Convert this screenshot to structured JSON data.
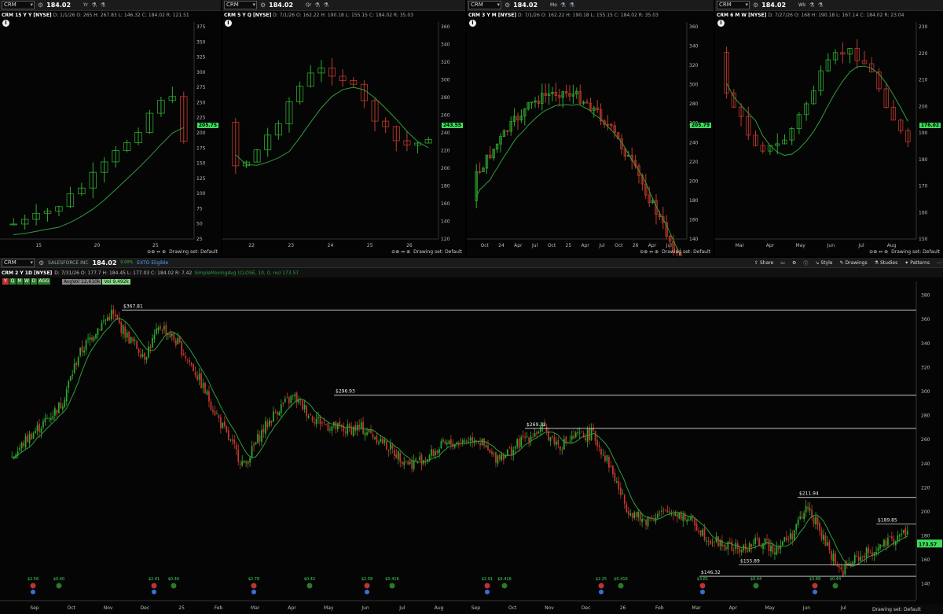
{
  "panels": [
    {
      "symbol": "CRM",
      "title": "CRM 15 Y Y [NYSE]",
      "price": "184.02",
      "period": "Yr",
      "stats": "D: 1/1/26  O: 265  H: 267.83  L: 146.32  C: 184.02  R: 121.51",
      "yticks": [
        "375",
        "350",
        "325",
        "300",
        "275",
        "250",
        "225",
        "200",
        "175",
        "150",
        "125",
        "100",
        "75",
        "50",
        "25"
      ],
      "xticks": [
        "15",
        "20",
        "25"
      ],
      "badge": "205.75",
      "drawing": "Drawing set: Default"
    },
    {
      "symbol": "CRM",
      "title": "CRM 5 Y Q [NYSE]",
      "price": "184.02",
      "period": "Qr",
      "stats": "D: 7/1/26  O: 162.22  H: 190.18  L: 155.15  C: 184.02  R: 35.03",
      "yticks": [
        "360",
        "340",
        "320",
        "300",
        "280",
        "260",
        "240",
        "220",
        "200",
        "180",
        "160",
        "140",
        "120"
      ],
      "xticks": [
        "22",
        "23",
        "24",
        "25",
        "26"
      ],
      "badge": "243.55",
      "drawing": "Drawing set: Default"
    },
    {
      "symbol": "CRM",
      "title": "CRM 3 Y M [NYSE]",
      "price": "184.02",
      "period": "Mo",
      "stats": "D: 7/1/26  O: 162.22  H: 190.18  L: 155.15  C: 184.02  R: 35.03",
      "yticks": [
        "360",
        "340",
        "320",
        "300",
        "280",
        "260",
        "240",
        "220",
        "200",
        "180",
        "160",
        "140"
      ],
      "xticks": [
        "Oct",
        "24",
        "Apr",
        "Jul",
        "Oct",
        "25",
        "Apr",
        "Jul",
        "Oct",
        "26",
        "Apr",
        "Jul"
      ],
      "badge": "205.79",
      "drawing": "Drawing set: Default"
    },
    {
      "symbol": "CRM",
      "title": "CRM 6 M W [NYSE]",
      "price": "184.02",
      "period": "Wk",
      "stats": "D: 7/27/26  O: 168  H: 190.18  L: 167.14  C: 184.02  R: 23.04",
      "yticks": [
        "230",
        "220",
        "210",
        "200",
        "190",
        "180",
        "170",
        "160",
        "150"
      ],
      "xticks": [
        "Mar",
        "Apr",
        "May",
        "Jun",
        "Jul",
        "Aug"
      ],
      "badge": "176.02",
      "drawing": "Drawing set: Default",
      "study": "SimpleMoving..."
    }
  ],
  "main": {
    "symbol": "CRM",
    "company": "SALESFORCE INC",
    "price": "184.02",
    "chg": "0.00%",
    "ext": "EXTO Eligible",
    "title": "CRM 2 Y 1D [NYSE]",
    "stats": "D: 7/31/26  O: 177.7  H: 184.45  L: 177.03  C: 184.02  R: 7.42",
    "study": "SimpleMovingAvg (CLOSE, 10, 0, no)  173.57",
    "avgvol": "AvgVol 12,610k",
    "vol": "Vol 9,492k",
    "agg": [
      "Y",
      "Q",
      "M",
      "W",
      "D",
      "AGG"
    ],
    "menu": {
      "share": "Share",
      "style": "Style",
      "drawings": "Drawings",
      "studies": "Studies",
      "patterns": "Patterns"
    },
    "yticks": [
      "380",
      "360",
      "340",
      "320",
      "300",
      "280",
      "260",
      "240",
      "220",
      "200",
      "180",
      "160",
      "140"
    ],
    "xticks": [
      "Sep",
      "Oct",
      "Nov",
      "Dec",
      "25",
      "Feb",
      "Mar",
      "Apr",
      "May",
      "Jun",
      "Jul",
      "Aug",
      "Sep",
      "Oct",
      "Nov",
      "Dec",
      "26",
      "Feb",
      "Mar",
      "Apr",
      "May",
      "Jun",
      "Jul",
      "Aug"
    ],
    "levels": [
      {
        "label": "$367.81",
        "value": 367.81
      },
      {
        "label": "$296.93",
        "value": 296.93
      },
      {
        "label": "$269.32",
        "value": 269.32
      },
      {
        "label": "$211.94",
        "value": 211.94
      },
      {
        "label": "$189.85",
        "value": 189.85
      },
      {
        "label": "$155.89",
        "value": 155.89
      },
      {
        "label": "$146.32",
        "value": 146.32
      }
    ],
    "badge": "173.57",
    "earnings": [
      "$2.56",
      "$0.40",
      "$2.41",
      "$0.40",
      "$2.78",
      "$0.42",
      "$2.58",
      "$0.416",
      "$2.91",
      "$0.416",
      "$2.25",
      "$0.416",
      "$3.81",
      "$0.44",
      "$3.88",
      "$0.44"
    ],
    "drawing": "Drawing set: Default"
  },
  "colors": {
    "up": "#2fa82f",
    "down": "#c0392b",
    "ma": "#2e9e3c",
    "badge": "#3ddc5a"
  },
  "chart_data": [
    {
      "type": "candlestick",
      "title": "CRM 15 Y Y [NYSE]",
      "x": [
        "11",
        "12",
        "13",
        "14",
        "15",
        "16",
        "17",
        "18",
        "19",
        "20",
        "21",
        "22",
        "23",
        "24",
        "25",
        "26"
      ],
      "close": [
        40,
        45,
        52,
        57,
        64,
        70,
        95,
        125,
        150,
        200,
        265,
        190,
        235,
        245,
        270,
        184
      ],
      "open": [
        32,
        40,
        45,
        52,
        57,
        63,
        70,
        95,
        125,
        150,
        200,
        265,
        190,
        235,
        340,
        265
      ],
      "ma_last": 205.75
    },
    {
      "type": "candlestick",
      "title": "CRM 5 Y Q [NYSE]",
      "x": [
        "22",
        "23",
        "24",
        "25",
        "26"
      ],
      "close": [
        235,
        228,
        208,
        188,
        165,
        150,
        183,
        230,
        255,
        280,
        270,
        300,
        315,
        320,
        280,
        255,
        205,
        165,
        184
      ],
      "open": [
        260,
        235,
        228,
        208,
        188,
        165,
        150,
        183,
        230,
        255,
        280,
        270,
        300,
        315,
        330,
        280,
        255,
        205,
        162
      ],
      "ma_last": 243.55
    },
    {
      "type": "candlestick",
      "title": "CRM 3 Y M [NYSE]",
      "x": [
        "Oct",
        "24",
        "Apr",
        "Jul",
        "Oct",
        "25",
        "Apr",
        "Jul",
        "Oct",
        "26",
        "Apr",
        "Jul"
      ],
      "ma_last": 205.79
    },
    {
      "type": "candlestick",
      "title": "CRM 6 M W [NYSE]",
      "x": [
        "Mar",
        "Apr",
        "May",
        "Jun",
        "Jul",
        "Aug"
      ],
      "ma_last": 176.02
    },
    {
      "type": "candlestick",
      "title": "CRM 2 Y 1D [NYSE]",
      "x": [
        "Sep",
        "Oct",
        "Nov",
        "Dec",
        "25",
        "Feb",
        "Mar",
        "Apr",
        "May",
        "Jun",
        "Jul",
        "Aug",
        "Sep",
        "Oct",
        "Nov",
        "Dec",
        "26",
        "Feb",
        "Mar",
        "Apr",
        "May",
        "Jun",
        "Jul",
        "Aug"
      ],
      "path_values": [
        245,
        262,
        275,
        290,
        330,
        350,
        365,
        345,
        330,
        355,
        340,
        318,
        290,
        262,
        238,
        265,
        285,
        296,
        280,
        272,
        268,
        270,
        262,
        250,
        240,
        245,
        255,
        258,
        262,
        245,
        250,
        262,
        269,
        255,
        262,
        265,
        240,
        205,
        192,
        198,
        200,
        192,
        178,
        172,
        168,
        175,
        170,
        180,
        205,
        175,
        150,
        162,
        168,
        175,
        184
      ],
      "ma_last": 173.57,
      "ylim": [
        130,
        385
      ]
    }
  ]
}
